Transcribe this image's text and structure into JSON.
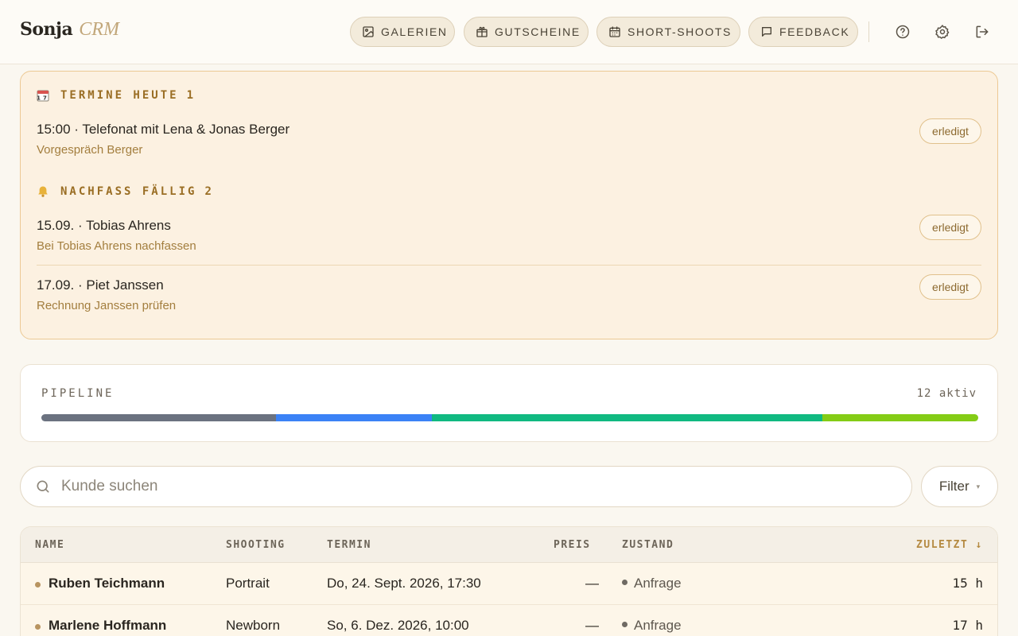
{
  "app": {
    "logo_main": "Sonja",
    "logo_sub": "CRM"
  },
  "nav": {
    "items": [
      {
        "label": "GALERIEN",
        "icon": "image-icon"
      },
      {
        "label": "GUTSCHEINE",
        "icon": "gift-icon"
      },
      {
        "label": "SHORT-SHOOTS",
        "icon": "calendar-icon"
      },
      {
        "label": "FEEDBACK",
        "icon": "message-icon"
      }
    ],
    "actions": [
      "help-icon",
      "settings-icon",
      "logout-icon"
    ]
  },
  "reminders": {
    "today": {
      "title": "TERMINE HEUTE",
      "count": "1",
      "items": [
        {
          "main": "15:00 · Telefonat mit Lena & Jonas Berger",
          "sub": "Vorgespräch Berger",
          "action": "erledigt"
        }
      ]
    },
    "followup": {
      "title": "NACHFASS FÄLLIG",
      "count": "2",
      "items": [
        {
          "main": "15.09. · Tobias Ahrens",
          "sub": "Bei Tobias Ahrens nachfassen",
          "action": "erledigt"
        },
        {
          "main": "17.09. · Piet Janssen",
          "sub": "Rechnung Janssen prüfen",
          "action": "erledigt"
        }
      ]
    }
  },
  "pipeline": {
    "title": "PIPELINE",
    "count_label": "12 aktiv",
    "segments": [
      {
        "value": 3,
        "color": "#6b7280"
      },
      {
        "value": 2,
        "color": "#3b82f6"
      },
      {
        "value": 5,
        "color": "#10b981"
      },
      {
        "value": 2,
        "color": "#84cc16"
      }
    ]
  },
  "search": {
    "placeholder": "Kunde suchen",
    "value": ""
  },
  "filter": {
    "label": "Filter",
    "caret": "▾"
  },
  "table": {
    "columns": {
      "name": "NAME",
      "shooting": "SHOOTING",
      "termin": "TERMIN",
      "preis": "PREIS",
      "zustand": "ZUSTAND",
      "zuletzt": "ZULETZT ↓"
    },
    "rows": [
      {
        "name": "Ruben Teichmann",
        "shooting": "Portrait",
        "termin": "Do, 24. Sept. 2026, 17:30",
        "preis": "—",
        "zustand": "Anfrage",
        "zuletzt": "15 h"
      },
      {
        "name": "Marlene Hoffmann",
        "shooting": "Newborn",
        "termin": "So, 6. Dez. 2026, 10:00",
        "preis": "—",
        "zustand": "Anfrage",
        "zuletzt": "17 h"
      }
    ]
  },
  "colors": {
    "accent": "#b58a42",
    "panel_border": "#ecc994",
    "panel_bg": "#fcf1e1"
  }
}
